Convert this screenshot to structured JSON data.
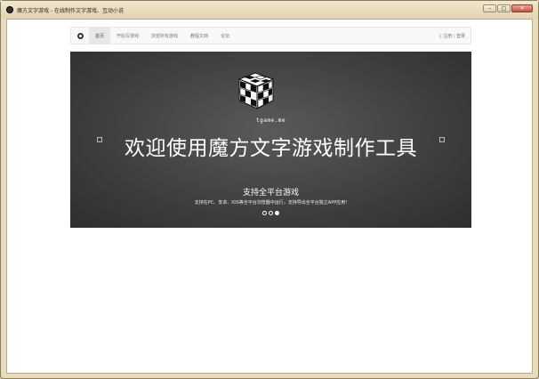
{
  "window": {
    "title": "魔方文字游戏 - 在线制作文字游戏、互动小说",
    "controls": [
      "–",
      "□",
      "✕"
    ]
  },
  "navbar": {
    "brand_icon": "logo-mark-icon",
    "items": [
      {
        "label": "首页",
        "active": true
      },
      {
        "label": "开始写游戏",
        "active": false
      },
      {
        "label": "浏览所有游戏",
        "active": false
      },
      {
        "label": "教程文档",
        "active": false
      },
      {
        "label": "论坛",
        "active": false
      }
    ],
    "auth": "▯ 注册 \\ 登录"
  },
  "hero": {
    "logo_icon": "rubiks-cube-icon",
    "logo_text": "tgame.me",
    "title": "欢迎使用魔方文字游戏制作工具",
    "subtitle": "支持全平台游戏",
    "description": "支持在PC、安卓、IOS等全平台浏览器中运行，支持导出全平台独立APP应用!",
    "prev_icon": "prev-arrow-icon",
    "next_icon": "next-arrow-icon",
    "indicators": [
      false,
      false,
      true
    ]
  },
  "colors": {
    "window_frame": "#e9dcbd",
    "hero_background": "#3e3e3e",
    "navbar_background": "#f8f8f8"
  }
}
